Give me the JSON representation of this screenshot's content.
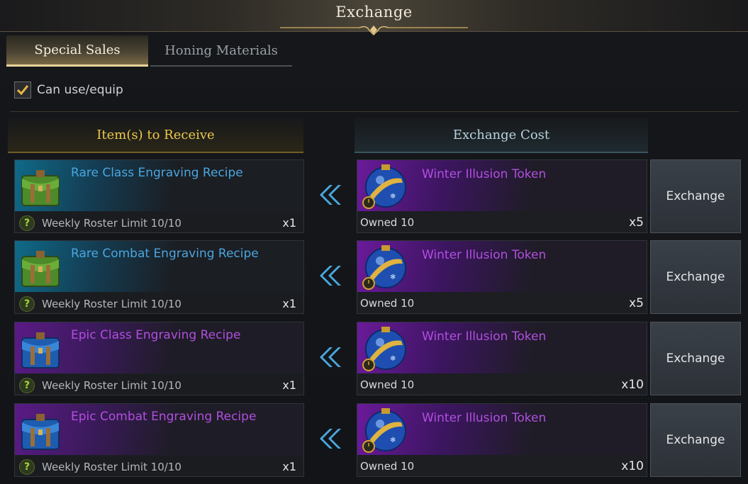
{
  "window": {
    "title": "Exchange"
  },
  "tabs": [
    {
      "label": "Special Sales",
      "active": true
    },
    {
      "label": "Honing Materials",
      "active": false
    }
  ],
  "filter": {
    "label": "Can use/equip",
    "checked": true
  },
  "columns": {
    "receive": "Item(s) to Receive",
    "cost": "Exchange Cost"
  },
  "rows": [
    {
      "item": {
        "name": "Rare Class Engraving Recipe",
        "rarity": "rare",
        "icon": "green-bag-icon",
        "limit": "Weekly Roster Limit 10/10",
        "qty": "x1"
      },
      "cost": {
        "name": "Winter Illusion Token",
        "icon": "ornament-token-icon",
        "owned": "Owned 10",
        "qty": "x5"
      },
      "button": "Exchange"
    },
    {
      "item": {
        "name": "Rare Combat Engraving Recipe",
        "rarity": "rare",
        "icon": "green-bag-icon",
        "limit": "Weekly Roster Limit 10/10",
        "qty": "x1"
      },
      "cost": {
        "name": "Winter Illusion Token",
        "icon": "ornament-token-icon",
        "owned": "Owned 10",
        "qty": "x5"
      },
      "button": "Exchange"
    },
    {
      "item": {
        "name": "Epic Class Engraving Recipe",
        "rarity": "epic",
        "icon": "blue-bag-icon",
        "limit": "Weekly Roster Limit 10/10",
        "qty": "x1"
      },
      "cost": {
        "name": "Winter Illusion Token",
        "icon": "ornament-token-icon",
        "owned": "Owned 10",
        "qty": "x10"
      },
      "button": "Exchange"
    },
    {
      "item": {
        "name": "Epic Combat Engraving Recipe",
        "rarity": "epic",
        "icon": "blue-bag-icon",
        "limit": "Weekly Roster Limit 10/10",
        "qty": "x1"
      },
      "cost": {
        "name": "Winter Illusion Token",
        "icon": "ornament-token-icon",
        "owned": "Owned 10",
        "qty": "x10"
      },
      "button": "Exchange"
    }
  ],
  "colors": {
    "rare": "#4aa6df",
    "epic": "#b14fe0",
    "header_gold": "#ecc94a",
    "limit_icon": "#a6d43a"
  }
}
